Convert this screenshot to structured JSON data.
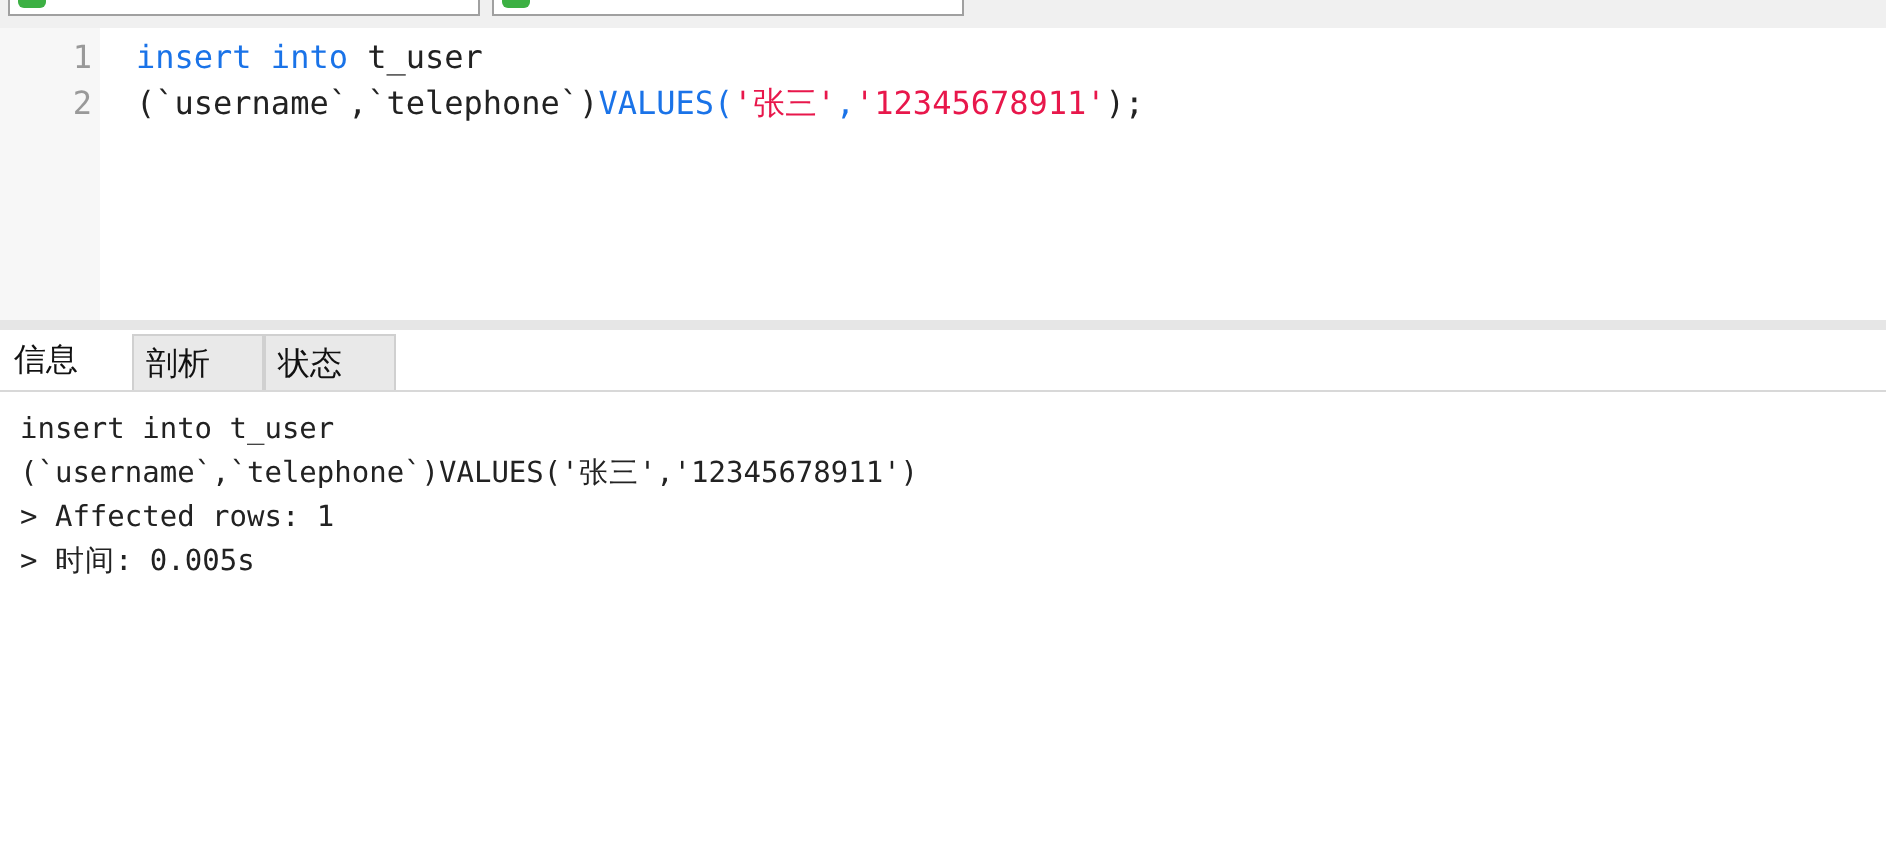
{
  "toolbar": {
    "fields": [
      {
        "kind": "field"
      },
      {
        "kind": "field"
      }
    ]
  },
  "editor": {
    "lines": [
      {
        "number": "1",
        "tokens": [
          {
            "text": "insert into",
            "kind": "keyword"
          },
          {
            "text": " t_user",
            "kind": "plain"
          }
        ]
      },
      {
        "number": "2",
        "tokens": [
          {
            "text": "(`username`,`telephone`)",
            "kind": "plain"
          },
          {
            "text": "VALUES(",
            "kind": "keyword"
          },
          {
            "text": "'张三'",
            "kind": "string"
          },
          {
            "text": ",",
            "kind": "keyword"
          },
          {
            "text": "'12345678911'",
            "kind": "string"
          },
          {
            "text": ");",
            "kind": "plain"
          }
        ]
      }
    ]
  },
  "tabs": [
    {
      "label": "信息",
      "selected": true
    },
    {
      "label": "剖析",
      "selected": false
    },
    {
      "label": "状态",
      "selected": false
    }
  ],
  "output": {
    "lines": [
      "insert into t_user",
      "(`username`,`telephone`)VALUES('张三','12345678911')",
      "> Affected rows: 1",
      "> 时间: 0.005s"
    ]
  }
}
